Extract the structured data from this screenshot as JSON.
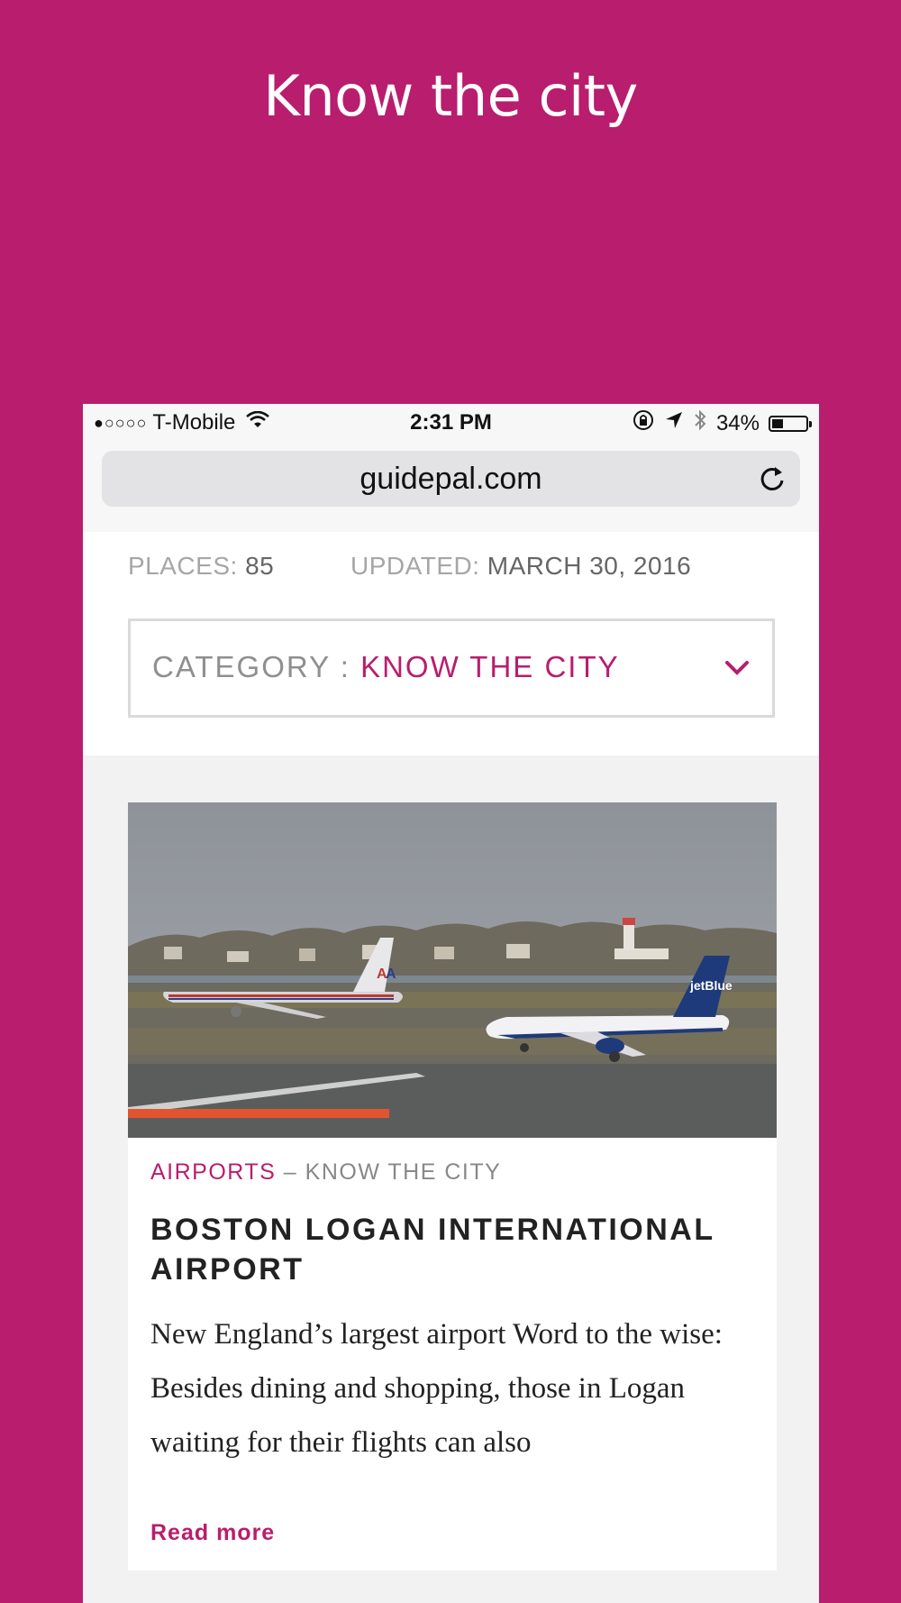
{
  "promo": {
    "title": "Know the city"
  },
  "status_bar": {
    "signal": "●○○○○",
    "carrier": "T-Mobile",
    "time": "2:31 PM",
    "battery_text": "34%",
    "battery_level": 0.34
  },
  "browser": {
    "url": "guidepal.com"
  },
  "info": {
    "places_label": "PLACES:",
    "places_value": "85",
    "updated_label": "UPDATED:",
    "updated_value": "MARCH 30, 2016"
  },
  "category": {
    "label": "CATEGORY :",
    "value": "KNOW THE CITY"
  },
  "card": {
    "tag_category": "AIRPORTS",
    "tag_separator": " – ",
    "tag_parent": "KNOW THE CITY",
    "title": "BOSTON LOGAN INTERNATIONAL AIRPORT",
    "description": "New England’s largest airport Word to the wise: Besides dining and shopping, those in Logan waiting for their flights can also",
    "read_more": "Read more"
  },
  "colors": {
    "accent": "#b91d6d",
    "background": "#b91d6d"
  }
}
